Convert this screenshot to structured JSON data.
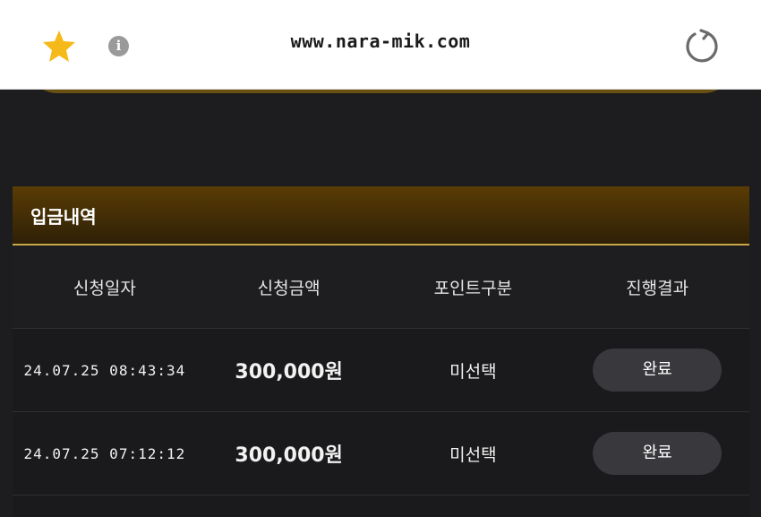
{
  "browser": {
    "url": "www.nara-mik.com",
    "info_glyph": "i",
    "star_icon": "star-icon",
    "reload_icon": "reload-icon"
  },
  "panel": {
    "title": "입금내역"
  },
  "table": {
    "headers": [
      "신청일자",
      "신청금액",
      "포인트구분",
      "진행결과"
    ],
    "rows": [
      {
        "date": "24.07.25 08:43:34",
        "amount": "300,000원",
        "point": "미선택",
        "status": "완료"
      },
      {
        "date": "24.07.25 07:12:12",
        "amount": "300,000원",
        "point": "미선택",
        "status": "완료"
      }
    ]
  },
  "colors": {
    "star": "#f6b91a",
    "accent_gold": "#c9a64a",
    "status_button": "#39393d"
  }
}
